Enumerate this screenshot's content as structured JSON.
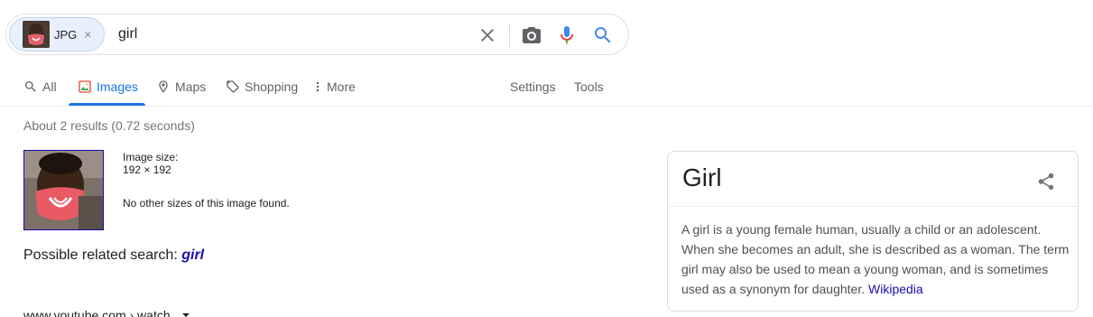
{
  "search": {
    "chip_label": "JPG",
    "chip_close": "×",
    "query": "girl"
  },
  "tabs": [
    {
      "label": "All",
      "icon": "search-icon"
    },
    {
      "label": "Images",
      "icon": "image-icon",
      "active": true
    },
    {
      "label": "Maps",
      "icon": "map-pin-icon"
    },
    {
      "label": "Shopping",
      "icon": "tag-icon"
    },
    {
      "label": "More",
      "icon": "kebab-icon"
    },
    {
      "label": "Settings"
    },
    {
      "label": "Tools"
    }
  ],
  "results": {
    "stats": "About 2 results (0.72 seconds)",
    "image_size_label": "Image size:",
    "image_size_value": "192 × 192",
    "no_other_sizes": "No other sizes of this image found.",
    "related_prefix": "Possible related search:",
    "related_term": "girl",
    "cite": "www.youtube.com › watch"
  },
  "knowledge_panel": {
    "title": "Girl",
    "description": "A girl is a young female human, usually a child or an adolescent. When she becomes an adult, she is described as a woman. The term girl may also be used to mean a young woman, and is sometimes used as a synonym for daughter.",
    "source": "Wikipedia"
  },
  "colors": {
    "accent": "#1a73e8",
    "link": "#1a0dab",
    "muted": "#70757a"
  }
}
